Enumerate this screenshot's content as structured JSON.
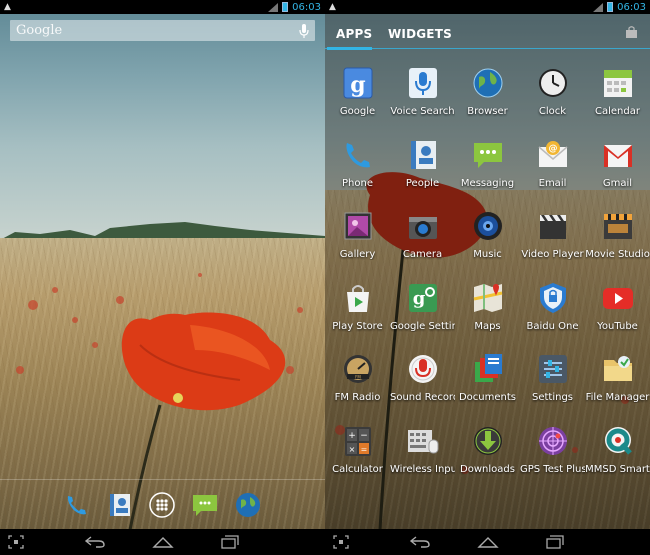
{
  "status_bar": {
    "time": "06:03"
  },
  "home": {
    "search": {
      "logo": "Google"
    }
  },
  "drawer": {
    "tabs": [
      {
        "label": "APPS",
        "active": true
      },
      {
        "label": "WIDGETS",
        "active": false
      }
    ],
    "apps": [
      {
        "label": "Google",
        "icon": "google-search-icon"
      },
      {
        "label": "Voice Search",
        "icon": "microphone-icon"
      },
      {
        "label": "Browser",
        "icon": "globe-icon"
      },
      {
        "label": "Clock",
        "icon": "clock-icon"
      },
      {
        "label": "Calendar",
        "icon": "calendar-icon"
      },
      {
        "label": "Phone",
        "icon": "phone-icon"
      },
      {
        "label": "People",
        "icon": "contacts-icon"
      },
      {
        "label": "Messaging",
        "icon": "message-bubble-icon"
      },
      {
        "label": "Email",
        "icon": "envelope-icon"
      },
      {
        "label": "Gmail",
        "icon": "gmail-icon"
      },
      {
        "label": "Gallery",
        "icon": "gallery-icon"
      },
      {
        "label": "Camera",
        "icon": "camera-icon"
      },
      {
        "label": "Music",
        "icon": "speaker-icon"
      },
      {
        "label": "Video Player",
        "icon": "clapperboard-icon"
      },
      {
        "label": "Movie Studio",
        "icon": "movie-studio-icon"
      },
      {
        "label": "Play Store",
        "icon": "shopping-bag-icon"
      },
      {
        "label": "Google Settings",
        "icon": "google-settings-icon"
      },
      {
        "label": "Maps",
        "icon": "map-icon"
      },
      {
        "label": "Baidu One",
        "icon": "shield-icon"
      },
      {
        "label": "YouTube",
        "icon": "youtube-icon"
      },
      {
        "label": "FM Radio",
        "icon": "radio-icon"
      },
      {
        "label": "Sound Recorder",
        "icon": "record-icon"
      },
      {
        "label": "Documents",
        "icon": "documents-icon"
      },
      {
        "label": "Settings",
        "icon": "sliders-icon"
      },
      {
        "label": "File Manager",
        "icon": "folder-icon"
      },
      {
        "label": "Calculator",
        "icon": "calculator-icon"
      },
      {
        "label": "Wireless Input",
        "icon": "keyboard-icon"
      },
      {
        "label": "Downloads",
        "icon": "download-icon"
      },
      {
        "label": "GPS Test Plus",
        "icon": "gps-icon"
      },
      {
        "label": "MMSD Smart",
        "icon": "q-logo-icon"
      }
    ]
  },
  "colors": {
    "accent": "#33b5e5",
    "youtube": "#e52d27",
    "gmail": "#d93025"
  }
}
